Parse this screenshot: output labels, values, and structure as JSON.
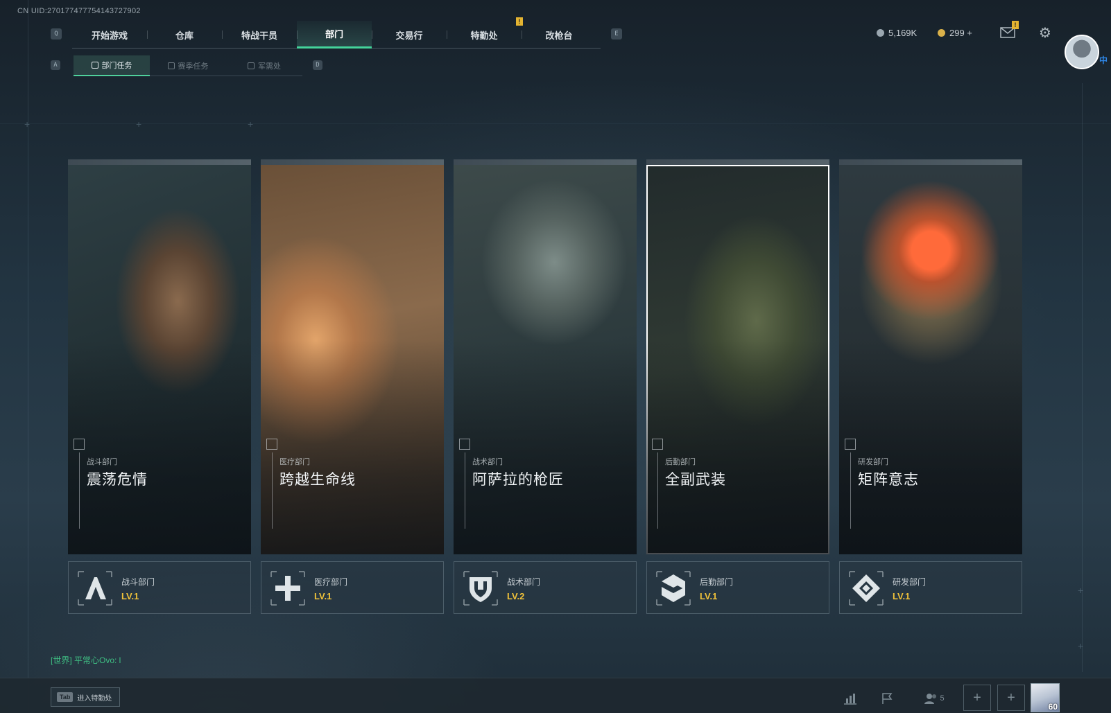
{
  "header": {
    "uid": "CN UID:270177477754143727902",
    "nav_prev_key": "Q",
    "nav_next_key": "E",
    "nav_tabs": [
      {
        "label": "开始游戏",
        "active": false
      },
      {
        "label": "仓库",
        "active": false
      },
      {
        "label": "特战干员",
        "active": false
      },
      {
        "label": "部门",
        "active": true
      },
      {
        "label": "交易行",
        "active": false
      },
      {
        "label": "特勤处",
        "active": false,
        "alert": "!"
      },
      {
        "label": "改枪台",
        "active": false
      }
    ],
    "sub_prev_key": "A",
    "sub_next_key": "D",
    "sub_tabs": [
      {
        "label": "部门任务",
        "active": true
      },
      {
        "label": "赛季任务",
        "active": false
      },
      {
        "label": "军需处",
        "active": false
      }
    ],
    "currency": [
      {
        "value": "5,169K",
        "color": "#9aa7b0"
      },
      {
        "value": "299 +",
        "color": "#d9b14a"
      }
    ],
    "mail_alert": "!",
    "lang": "中"
  },
  "cards": [
    {
      "dept": "战斗部门",
      "title": "震荡危情",
      "level": "LV.1",
      "icon": "combat-dept-icon",
      "selected": false
    },
    {
      "dept": "医疗部门",
      "title": "跨越生命线",
      "level": "LV.1",
      "icon": "medical-dept-icon",
      "selected": false
    },
    {
      "dept": "战术部门",
      "title": "阿萨拉的枪匠",
      "level": "LV.2",
      "icon": "tactical-dept-icon",
      "selected": false
    },
    {
      "dept": "后勤部门",
      "title": "全副武装",
      "level": "LV.1",
      "icon": "logistics-dept-icon",
      "selected": true
    },
    {
      "dept": "研发部门",
      "title": "矩阵意志",
      "level": "LV.1",
      "icon": "rnd-dept-icon",
      "selected": false
    }
  ],
  "footer": {
    "chat": "[世界] 平常心Ovo: l",
    "tab_key": "Tab",
    "tab_hint": "进入特勤处",
    "party_count": "5",
    "player_level": "60"
  },
  "colors": {
    "accent": "#44d49b",
    "level": "#f0c23a",
    "chat": "#3fbf83"
  }
}
